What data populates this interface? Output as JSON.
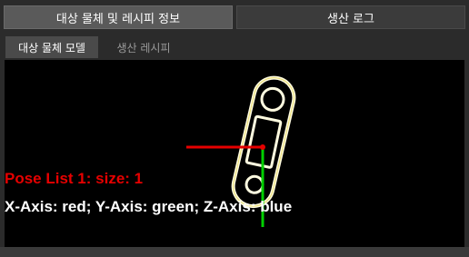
{
  "top_tabs": [
    {
      "label": "대상 물체 및 레시피 정보"
    },
    {
      "label": "생산 로그"
    }
  ],
  "sub_tabs": [
    {
      "label": "대상 물체 모델"
    },
    {
      "label": "생산 레시피"
    }
  ],
  "viewer": {
    "pose_text": "Pose List 1: size: 1",
    "axis_text": "X-Axis: red; Y-Axis: green; Z-Axis: blue",
    "colors": {
      "x_axis": "#e60000",
      "y_axis": "#00d000",
      "contour": "#fffbe0",
      "contour_accent": "#e0d040"
    }
  }
}
